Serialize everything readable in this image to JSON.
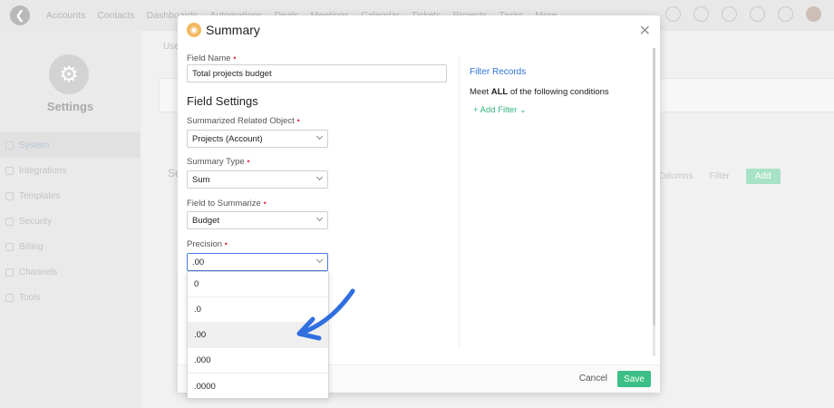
{
  "app": {
    "nav": [
      "Accounts",
      "Contacts",
      "Dashboards",
      "Automations",
      "Deals",
      "Meetings",
      "Calendar",
      "Tickets",
      "Projects",
      "Tasks",
      "More"
    ],
    "settings_title": "Settings",
    "sidebar_items": [
      "System",
      "Integrations",
      "Templates",
      "Security",
      "Billing",
      "Channels",
      "Tools"
    ],
    "breadcrumb": "Use",
    "section_stub": "Se",
    "toolbar": {
      "columns": "Columns",
      "filter": "Filter",
      "add": "Add"
    }
  },
  "modal": {
    "title": "Summary",
    "field_name": {
      "label": "Field Name",
      "value": "Total projects budget"
    },
    "section_title": "Field Settings",
    "related_object": {
      "label": "Summarized Related Object",
      "value": "Projects (Account)"
    },
    "summary_type": {
      "label": "Summary Type",
      "value": "Sum"
    },
    "field_to_summarize": {
      "label": "Field to Summarize",
      "value": "Budget"
    },
    "precision": {
      "label": "Precision",
      "value": ".00",
      "options": [
        "0",
        ".0",
        ".00",
        ".000",
        ".0000"
      ],
      "selected_index": 2
    },
    "filter": {
      "title": "Filter Records",
      "condition_prefix": "Meet",
      "condition_bold": "ALL",
      "condition_suffix": "of the following conditions",
      "add_filter": "+ Add Filter"
    },
    "footer": {
      "cancel": "Cancel",
      "save": "Save"
    }
  },
  "colors": {
    "accent_blue": "#2f73d8",
    "accent_green": "#3bbf86",
    "required_red": "#e0334b",
    "annotation_arrow": "#2f6fe0"
  },
  "icons": {
    "logo": "back-arrow-circle-icon",
    "settings_logo": "gear-icon",
    "modal_icon": "summary-icon",
    "close": "close-icon",
    "annotation": "arrow-pointer-annotation"
  }
}
